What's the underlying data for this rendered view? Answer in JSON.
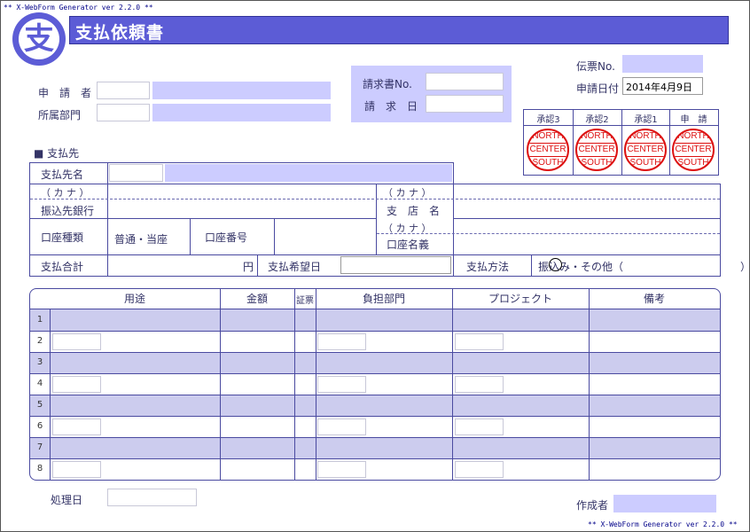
{
  "generator_top": "** X-WebForm Generator ver 2.2.0 **",
  "generator_bottom": "** X-WebForm Generator ver 2.2.0 **",
  "logo_char": "支",
  "title": "支払依頼書",
  "header": {
    "slip_no_label": "伝票No.",
    "slip_no_value": "",
    "apply_date_label": "申請日付",
    "apply_date_value": "2014年4月9日",
    "invoice_no_label": "請求書No.",
    "invoice_date_label": "請　求　日",
    "applicant_label": "申　請　者",
    "department_label": "所属部門"
  },
  "approvals": {
    "labels": [
      "承認3",
      "承認2",
      "承認1",
      "申　請"
    ],
    "stamp_lines": [
      "NORTH",
      "CENTER",
      "SOUTH"
    ]
  },
  "payee": {
    "section_label": "■ 支払先",
    "name_label": "支払先名",
    "kana_label_left": "（ カ ナ ）",
    "bank_label": "振込先銀行",
    "kana_label_right": "（ カ ナ ）",
    "branch_label": "支　店　名",
    "account_type_label": "口座種類",
    "account_type_value": "普通・当座",
    "account_no_label": "口座番号",
    "kana_label_holder": "（ カ ナ ）",
    "account_holder_label": "口座名義",
    "total_label": "支払合計",
    "yen": "円",
    "desired_date_label": "支払希望日",
    "method_label": "支払方法",
    "method_value": "振込み・その他（　　　　　　　　　　　）"
  },
  "table": {
    "headers": [
      "用途",
      "金額",
      "証票",
      "負担部門",
      "プロジェクト",
      "備考"
    ],
    "row_numbers": [
      "1",
      "2",
      "3",
      "4",
      "5",
      "6",
      "7",
      "8"
    ]
  },
  "footer": {
    "processed_date_label": "処理日",
    "creator_label": "作成者"
  },
  "colors": {
    "accent": "#5c5cd6",
    "fill": "#ccccff",
    "line": "#4a4aa0",
    "stamp": "#dd1111"
  }
}
